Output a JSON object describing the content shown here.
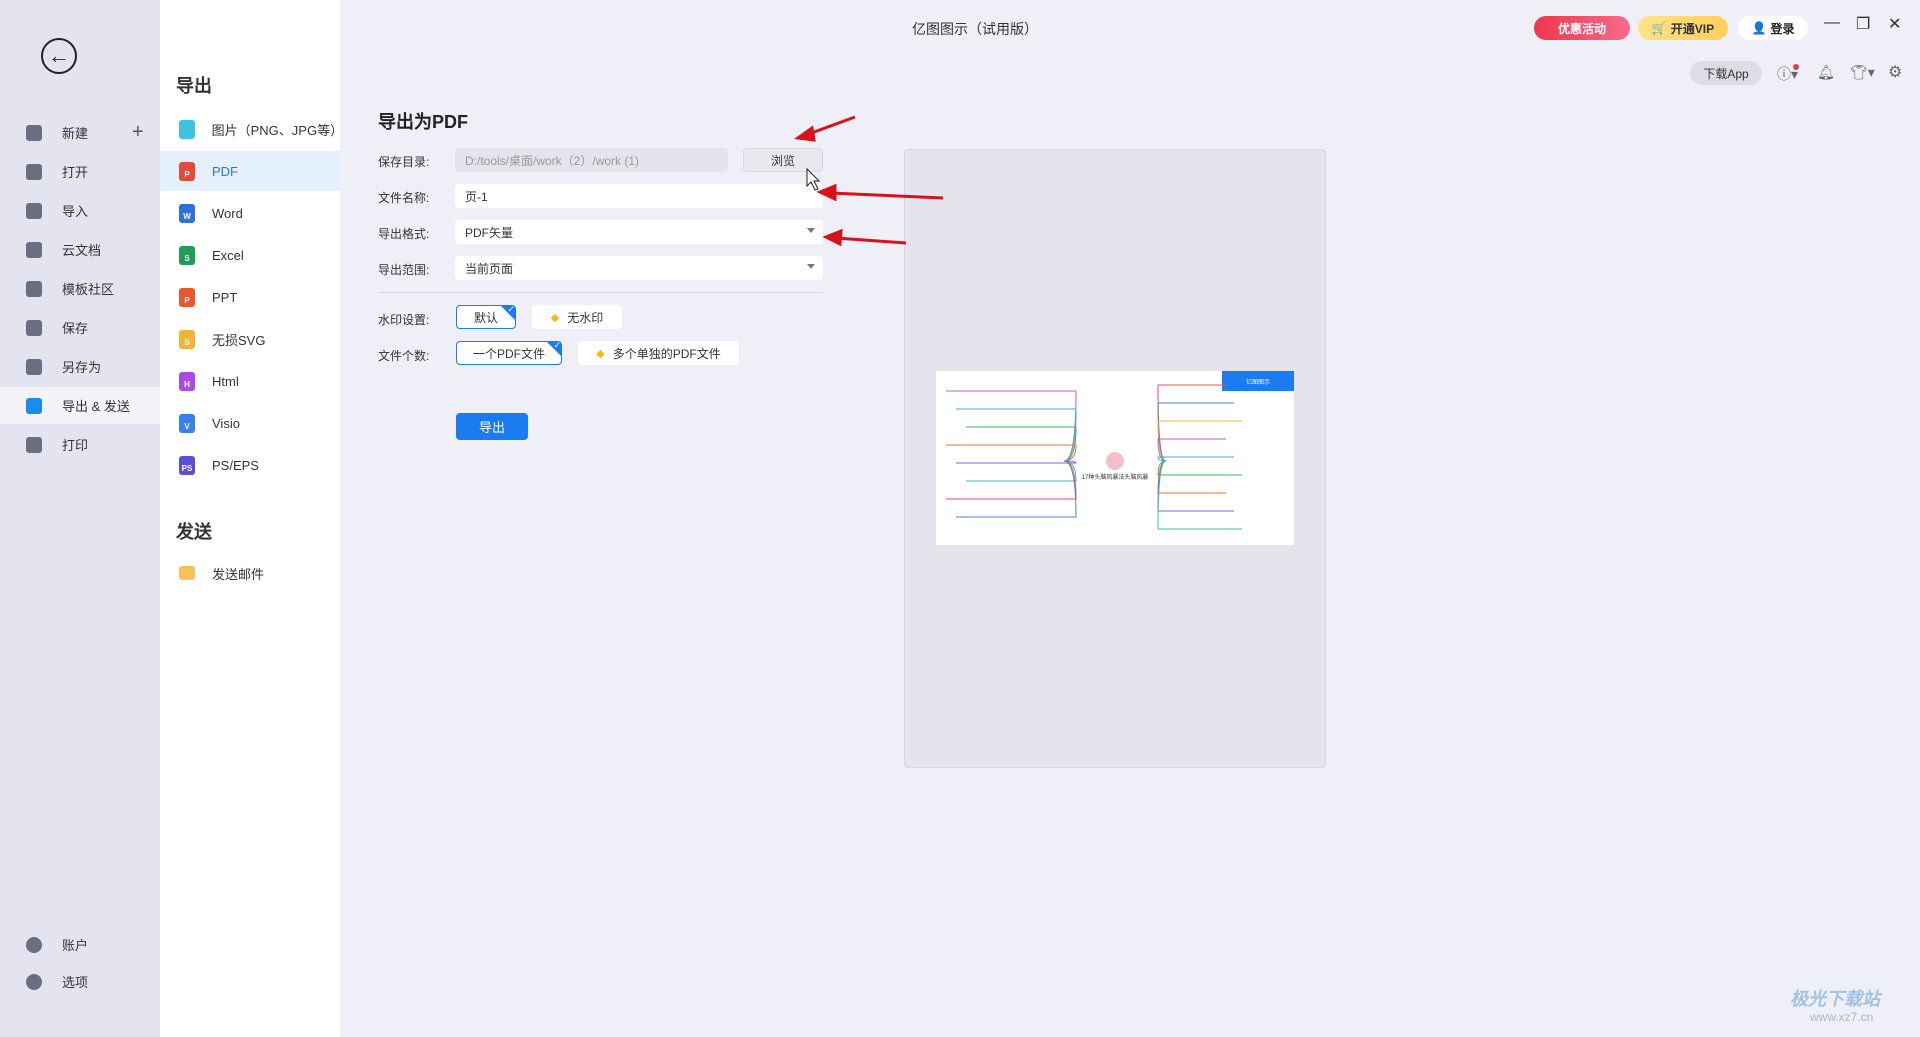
{
  "window": {
    "title": "亿图图示（试用版）",
    "promo": "优惠活动",
    "vip": "开通VIP",
    "login": "登录",
    "download_app": "下载App"
  },
  "nav": {
    "items": [
      {
        "label": "新建",
        "icon": "plus-square-icon"
      },
      {
        "label": "打开",
        "icon": "folder-icon"
      },
      {
        "label": "导入",
        "icon": "import-icon"
      },
      {
        "label": "云文档",
        "icon": "cloud-icon"
      },
      {
        "label": "模板社区",
        "icon": "community-icon"
      },
      {
        "label": "保存",
        "icon": "save-icon"
      },
      {
        "label": "另存为",
        "icon": "save-as-icon"
      },
      {
        "label": "导出 & 发送",
        "icon": "export-icon",
        "active": true
      },
      {
        "label": "打印",
        "icon": "print-icon"
      }
    ],
    "bottom": [
      {
        "label": "账户",
        "icon": "account-icon"
      },
      {
        "label": "选项",
        "icon": "gear-icon"
      }
    ]
  },
  "export_list": {
    "heading": "导出",
    "items": [
      {
        "label": "图片（PNG、JPG等）",
        "color": "#3fc3e0",
        "letter": ""
      },
      {
        "label": "PDF",
        "color": "#e6483d",
        "letter": "P",
        "active": true
      },
      {
        "label": "Word",
        "color": "#2f6fe0",
        "letter": "W"
      },
      {
        "label": "Excel",
        "color": "#1f9d55",
        "letter": "S"
      },
      {
        "label": "PPT",
        "color": "#e8572d",
        "letter": "P"
      },
      {
        "label": "无损SVG",
        "color": "#f0b43c",
        "letter": "S"
      },
      {
        "label": "Html",
        "color": "#a84be8",
        "letter": "H"
      },
      {
        "label": "Visio",
        "color": "#3a7ff0",
        "letter": "V"
      },
      {
        "label": "PS/EPS",
        "color": "#5b4fd6",
        "letter": "PS"
      }
    ],
    "send_heading": "发送",
    "send_items": [
      {
        "label": "发送邮件",
        "color": "#f7c25a"
      }
    ]
  },
  "form": {
    "title": "导出为PDF",
    "save_dir_label": "保存目录:",
    "save_dir_value": "D:/tools/桌面/work（2）/work (1)",
    "browse": "浏览",
    "filename_label": "文件名称:",
    "filename_value": "页-1",
    "format_label": "导出格式:",
    "format_value": "PDF矢量",
    "range_label": "导出范围:",
    "range_value": "当前页面",
    "watermark_label": "水印设置:",
    "watermark_default": "默认",
    "watermark_none": "无水印",
    "count_label": "文件个数:",
    "count_one": "一个PDF文件",
    "count_multi": "多个单独的PDF文件",
    "export_button": "导出"
  },
  "preview": {
    "center_title": "17种头脑风暴法头脑风暴",
    "logo": "亿图图示"
  },
  "colors": {
    "accent": "#1a7cf0",
    "promo": "#f0374e",
    "vip": "#ffd86b",
    "arrow": "#d8121a"
  },
  "watermark": {
    "text": "极光下载站",
    "url": "www.xz7.cn"
  }
}
